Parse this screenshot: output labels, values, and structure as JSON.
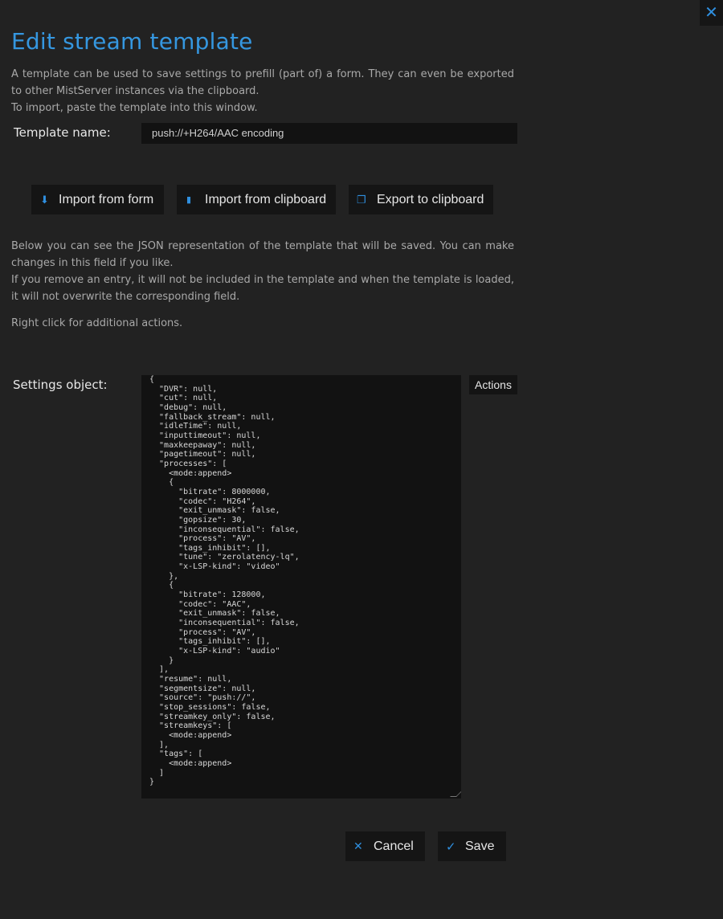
{
  "dialog": {
    "close_glyph": "✕",
    "title": "Edit stream template",
    "intro_line1": "A template can be used to save settings to prefill (part of) a form. They can even be exported to other MistServer instances via the clipboard.",
    "intro_line2": "To import, paste the template into this window."
  },
  "template_name": {
    "label": "Template name:",
    "value": "push://+H264/AAC encoding"
  },
  "toolbar": {
    "import_form": {
      "label": "Import from form",
      "icon": "download-icon",
      "glyph": "⬇"
    },
    "import_clipboard": {
      "label": "Import from clipboard",
      "icon": "clipboard-icon",
      "glyph": "▮"
    },
    "export_clipboard": {
      "label": "Export to clipboard",
      "icon": "copy-icon",
      "glyph": "❐"
    }
  },
  "description": {
    "line1": "Below you can see the JSON representation of the template that will be saved. You can make changes in this field if you like.",
    "line2": "If you remove an entry, it will not be included in the template and when the template is loaded, it will not overwrite the corresponding field.",
    "hint": "Right click for additional actions."
  },
  "settings": {
    "label": "Settings object:",
    "actions_label": "Actions",
    "json_text": "{\n  \"DVR\": null,\n  \"cut\": null,\n  \"debug\": null,\n  \"fallback_stream\": null,\n  \"idleTime\": null,\n  \"inputtimeout\": null,\n  \"maxkeepaway\": null,\n  \"pagetimeout\": null,\n  \"processes\": [\n    <mode:append>\n    {\n      \"bitrate\": 8000000,\n      \"codec\": \"H264\",\n      \"exit_unmask\": false,\n      \"gopsize\": 30,\n      \"inconsequential\": false,\n      \"process\": \"AV\",\n      \"tags_inhibit\": [],\n      \"tune\": \"zerolatency-lq\",\n      \"x-LSP-kind\": \"video\"\n    },\n    {\n      \"bitrate\": 128000,\n      \"codec\": \"AAC\",\n      \"exit_unmask\": false,\n      \"inconsequential\": false,\n      \"process\": \"AV\",\n      \"tags_inhibit\": [],\n      \"x-LSP-kind\": \"audio\"\n    }\n  ],\n  \"resume\": null,\n  \"segmentsize\": null,\n  \"source\": \"push://\",\n  \"stop_sessions\": false,\n  \"streamkey_only\": false,\n  \"streamkeys\": [\n    <mode:append>\n  ],\n  \"tags\": [\n    <mode:append>\n  ]\n}"
  },
  "footer": {
    "cancel": {
      "label": "Cancel",
      "glyph": "✕"
    },
    "save": {
      "label": "Save",
      "glyph": "✓"
    }
  },
  "colors": {
    "accent": "#3597e0",
    "background": "#222222",
    "field": "#121212"
  }
}
